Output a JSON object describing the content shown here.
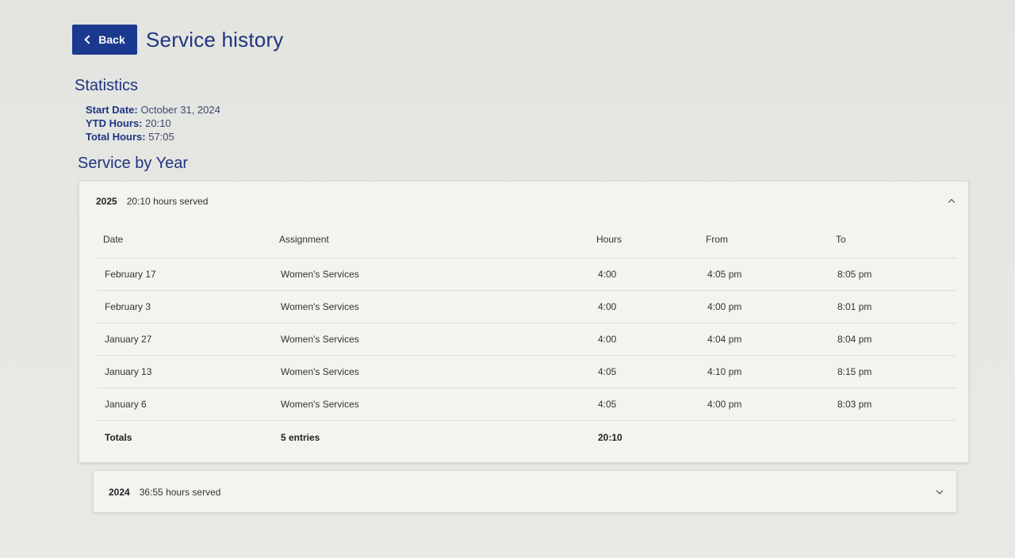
{
  "header": {
    "back_label": "Back",
    "title": "Service history"
  },
  "statistics": {
    "heading": "Statistics",
    "start_date_label": "Start Date:",
    "start_date_value": "October 31, 2024",
    "ytd_label": "YTD Hours:",
    "ytd_value": "20:10",
    "total_label": "Total Hours:",
    "total_value": "57:05"
  },
  "service_by_year": {
    "heading": "Service by Year",
    "years": [
      {
        "year": "2025",
        "served": "20:10 hours served",
        "expanded": true,
        "columns": [
          "Date",
          "Assignment",
          "Hours",
          "From",
          "To"
        ],
        "rows": [
          [
            "February 17",
            "Women's Services",
            "4:00",
            "4:05 pm",
            "8:05 pm"
          ],
          [
            "February 3",
            "Women's Services",
            "4:00",
            "4:00 pm",
            "8:01 pm"
          ],
          [
            "January 27",
            "Women's Services",
            "4:00",
            "4:04 pm",
            "8:04 pm"
          ],
          [
            "January 13",
            "Women's Services",
            "4:05",
            "4:10 pm",
            "8:15 pm"
          ],
          [
            "January 6",
            "Women's Services",
            "4:05",
            "4:00 pm",
            "8:03 pm"
          ]
        ],
        "totals": {
          "label": "Totals",
          "entries": "5 entries",
          "hours": "20:10"
        }
      },
      {
        "year": "2024",
        "served": "36:55 hours served",
        "expanded": false
      }
    ]
  },
  "icons": {
    "back": "chevron-left-icon",
    "collapse": "chevron-up-icon",
    "expand": "chevron-down-icon"
  },
  "colors": {
    "accent": "#1b3a8f",
    "heading": "#1f3580",
    "background": "#e6e7e3"
  }
}
